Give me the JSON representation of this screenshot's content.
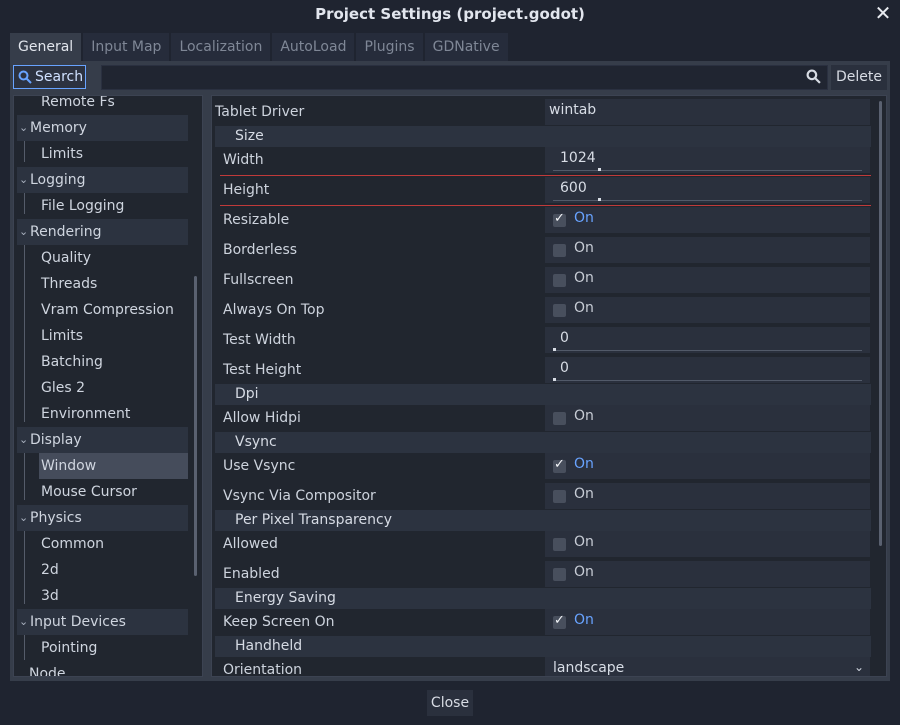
{
  "window": {
    "title": "Project Settings (project.godot)",
    "close_label": "Close"
  },
  "tabs": [
    {
      "label": "General",
      "active": true
    },
    {
      "label": "Input Map"
    },
    {
      "label": "Localization"
    },
    {
      "label": "AutoLoad"
    },
    {
      "label": "Plugins"
    },
    {
      "label": "GDNative"
    }
  ],
  "toolbar": {
    "search_label": "Search",
    "filter_placeholder": "",
    "delete_label": "Delete"
  },
  "sidebar": {
    "items": [
      {
        "label": "Remote Fs",
        "kind": "child"
      },
      {
        "label": "Memory",
        "kind": "category"
      },
      {
        "label": "Limits",
        "kind": "child"
      },
      {
        "label": "Logging",
        "kind": "category"
      },
      {
        "label": "File Logging",
        "kind": "child"
      },
      {
        "label": "Rendering",
        "kind": "category"
      },
      {
        "label": "Quality",
        "kind": "child"
      },
      {
        "label": "Threads",
        "kind": "child"
      },
      {
        "label": "Vram Compression",
        "kind": "child"
      },
      {
        "label": "Limits",
        "kind": "child"
      },
      {
        "label": "Batching",
        "kind": "child"
      },
      {
        "label": "Gles 2",
        "kind": "child"
      },
      {
        "label": "Environment",
        "kind": "child"
      },
      {
        "label": "Display",
        "kind": "category"
      },
      {
        "label": "Window",
        "kind": "child",
        "selected": true
      },
      {
        "label": "Mouse Cursor",
        "kind": "child"
      },
      {
        "label": "Physics",
        "kind": "category"
      },
      {
        "label": "Common",
        "kind": "child"
      },
      {
        "label": "2d",
        "kind": "child"
      },
      {
        "label": "3d",
        "kind": "child"
      },
      {
        "label": "Input Devices",
        "kind": "category"
      },
      {
        "label": "Pointing",
        "kind": "child"
      },
      {
        "label": "Node",
        "kind": "root"
      }
    ]
  },
  "properties": {
    "on_label": "On",
    "tablet_driver": {
      "label": "Tablet Driver",
      "value": "wintab"
    },
    "sections": {
      "size": "Size",
      "dpi": "Dpi",
      "vsync": "Vsync",
      "per_pixel": "Per Pixel Transparency",
      "energy": "Energy Saving",
      "handheld": "Handheld"
    },
    "width": {
      "label": "Width",
      "value": "1024",
      "fraction": 0.146
    },
    "height": {
      "label": "Height",
      "value": "600",
      "fraction": 0.146
    },
    "resizable": {
      "label": "Resizable",
      "checked": true
    },
    "borderless": {
      "label": "Borderless",
      "checked": false
    },
    "fullscreen": {
      "label": "Fullscreen",
      "checked": false
    },
    "always_on_top": {
      "label": "Always On Top",
      "checked": false
    },
    "test_width": {
      "label": "Test Width",
      "value": "0",
      "fraction": 0
    },
    "test_height": {
      "label": "Test Height",
      "value": "0",
      "fraction": 0
    },
    "allow_hidpi": {
      "label": "Allow Hidpi",
      "checked": false
    },
    "use_vsync": {
      "label": "Use Vsync",
      "checked": true
    },
    "vsync_via_compositor": {
      "label": "Vsync Via Compositor",
      "checked": false
    },
    "allowed": {
      "label": "Allowed",
      "checked": false
    },
    "enabled": {
      "label": "Enabled",
      "checked": false
    },
    "keep_screen_on": {
      "label": "Keep Screen On",
      "checked": true
    },
    "orientation": {
      "label": "Orientation",
      "value": "landscape"
    }
  },
  "colors": {
    "accent": "#68a3ff",
    "panel": "#363d4a",
    "modified_line": "#c03a3a"
  },
  "icons": {
    "search": "magnifier-icon",
    "close": "close-icon",
    "dropdown": "chevron-down-icon"
  }
}
